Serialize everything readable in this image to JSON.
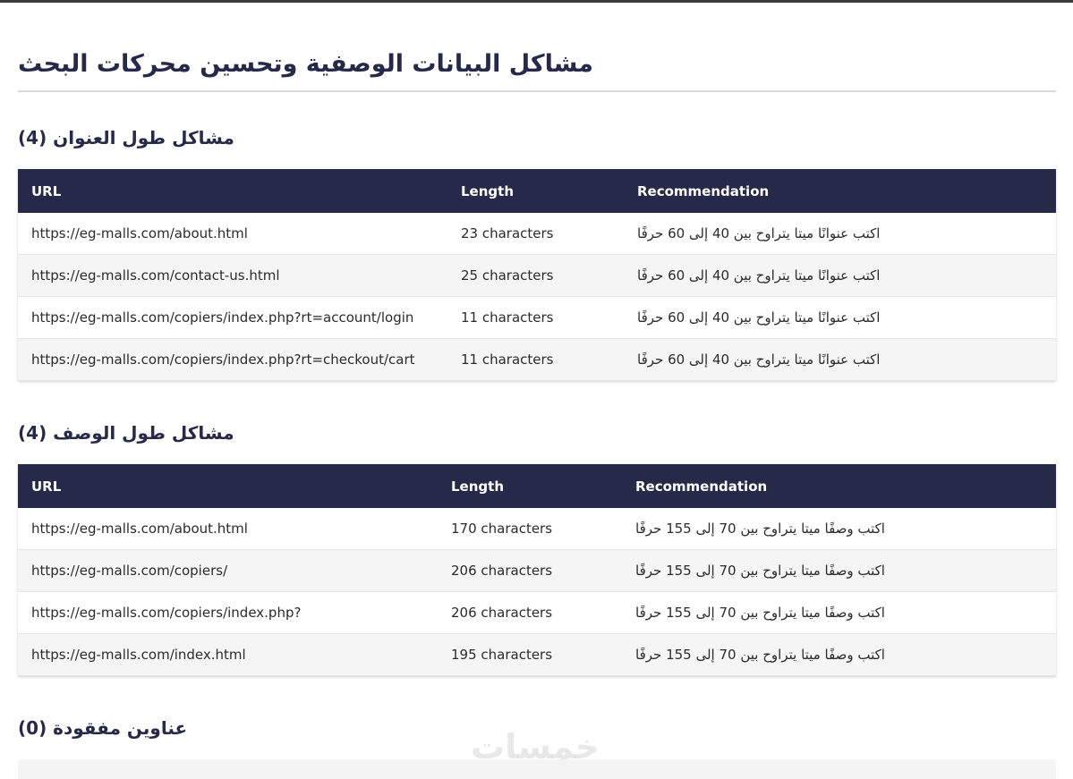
{
  "page_title": "مشاكل البيانات الوصفية وتحسين محركات البحث",
  "columns": {
    "url": "URL",
    "length": "Length",
    "recommendation": "Recommendation"
  },
  "title_section": {
    "heading": "مشاكل طول العنوان (4)",
    "rows": [
      {
        "url": "https://eg-malls.com/about.html",
        "length": "23 characters",
        "recommendation": "اكتب عنوانًا ميتا يتراوح بين 40 إلى 60 حرفًا"
      },
      {
        "url": "https://eg-malls.com/contact-us.html",
        "length": "25 characters",
        "recommendation": "اكتب عنوانًا ميتا يتراوح بين 40 إلى 60 حرفًا"
      },
      {
        "url": "https://eg-malls.com/copiers/index.php?rt=account/login",
        "length": "11 characters",
        "recommendation": "اكتب عنوانًا ميتا يتراوح بين 40 إلى 60 حرفًا"
      },
      {
        "url": "https://eg-malls.com/copiers/index.php?rt=checkout/cart",
        "length": "11 characters",
        "recommendation": "اكتب عنوانًا ميتا يتراوح بين 40 إلى 60 حرفًا"
      }
    ]
  },
  "description_section": {
    "heading": "مشاكل طول الوصف (4)",
    "rows": [
      {
        "url": "https://eg-malls.com/about.html",
        "length": "170 characters",
        "recommendation": "اكتب وصفًا ميتا يتراوح بين 70 إلى 155 حرفًا"
      },
      {
        "url": "https://eg-malls.com/copiers/",
        "length": "206 characters",
        "recommendation": "اكتب وصفًا ميتا يتراوح بين 70 إلى 155 حرفًا"
      },
      {
        "url": "https://eg-malls.com/copiers/index.php?",
        "length": "206 characters",
        "recommendation": "اكتب وصفًا ميتا يتراوح بين 70 إلى 155 حرفًا"
      },
      {
        "url": "https://eg-malls.com/index.html",
        "length": "195 characters",
        "recommendation": "اكتب وصفًا ميتا يتراوح بين 70 إلى 155 حرفًا"
      }
    ]
  },
  "missing_section": {
    "heading": "عناوين مفقودة (0)"
  },
  "watermark": "خمسات"
}
